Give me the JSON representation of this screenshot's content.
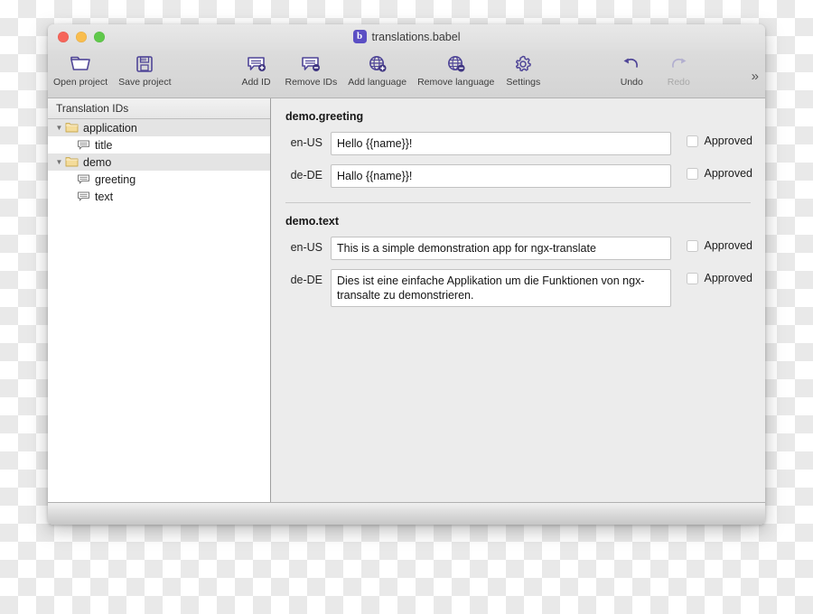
{
  "window": {
    "title": "translations.babel",
    "app_icon": "babel-app-icon",
    "app_icon_glyph": "b",
    "accent_color": "#5b4fc4",
    "traffic_lights": [
      {
        "name": "close",
        "color": "#f6655a"
      },
      {
        "name": "minimize",
        "color": "#f9bd4e"
      },
      {
        "name": "zoom",
        "color": "#60c94b"
      }
    ]
  },
  "toolbar": {
    "overflow_label": "»",
    "items": [
      {
        "label": "Open project",
        "icon": "open-folder-icon",
        "disabled": false
      },
      {
        "label": "Save project",
        "icon": "floppy-disk-icon",
        "disabled": false
      },
      {
        "label": "Add ID",
        "icon": "speech-bubble-plus-icon",
        "disabled": false
      },
      {
        "label": "Remove IDs",
        "icon": "speech-bubble-minus-icon",
        "disabled": false
      },
      {
        "label": "Add language",
        "icon": "globe-plus-icon",
        "disabled": false
      },
      {
        "label": "Remove language",
        "icon": "globe-minus-icon",
        "disabled": false
      },
      {
        "label": "Settings",
        "icon": "gear-icon",
        "disabled": false
      },
      {
        "label": "Undo",
        "icon": "undo-arrow-icon",
        "disabled": false
      },
      {
        "label": "Redo",
        "icon": "redo-arrow-icon",
        "disabled": true
      }
    ]
  },
  "sidebar": {
    "header": "Translation IDs",
    "tree": [
      {
        "label": "application",
        "icon": "folder-icon",
        "type": "folder",
        "expanded": true,
        "depth": 0,
        "stripe": true
      },
      {
        "label": "title",
        "icon": "speech-bubble-icon",
        "type": "leaf",
        "expanded": false,
        "depth": 1,
        "stripe": false
      },
      {
        "label": "demo",
        "icon": "folder-icon",
        "type": "folder",
        "expanded": true,
        "depth": 0,
        "stripe": true
      },
      {
        "label": "greeting",
        "icon": "speech-bubble-icon",
        "type": "leaf",
        "expanded": false,
        "depth": 1,
        "stripe": false
      },
      {
        "label": "text",
        "icon": "speech-bubble-icon",
        "type": "leaf",
        "expanded": false,
        "depth": 1,
        "stripe": false
      }
    ],
    "disclosure_glyph": "▼"
  },
  "main": {
    "sections": [
      {
        "title": "demo.greeting",
        "rows": [
          {
            "lang": "en-US",
            "value": "Hello {{name}}!",
            "approved_label": "Approved",
            "approved": false,
            "tall": false
          },
          {
            "lang": "de-DE",
            "value": "Hallo {{name}}!",
            "approved_label": "Approved",
            "approved": false,
            "tall": false
          }
        ]
      },
      {
        "title": "demo.text",
        "rows": [
          {
            "lang": "en-US",
            "value": "This is a simple demonstration app for ngx-translate",
            "approved_label": "Approved",
            "approved": false,
            "tall": false
          },
          {
            "lang": "de-DE",
            "value": "Dies ist eine einfache Applikation um die Funktionen von ngx-transalte zu demonstrieren.",
            "approved_label": "Approved",
            "approved": false,
            "tall": true
          }
        ]
      }
    ]
  }
}
